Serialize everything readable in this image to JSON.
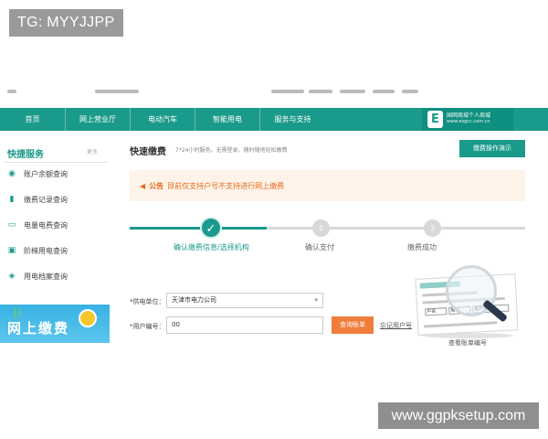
{
  "overlays": {
    "tg_label": "TG: MYYJJPP",
    "watermark": "www.ggpksetup.com"
  },
  "navbar": {
    "items": [
      {
        "label": "首页"
      },
      {
        "label": "网上营业厅"
      },
      {
        "label": "电动汽车"
      },
      {
        "label": "智能用电"
      },
      {
        "label": "服务与支持"
      }
    ],
    "brand_name": "国网商城个人商城",
    "brand_url": "www.esgcc.com.cn",
    "brand_logo_icon": "e-logo-icon"
  },
  "sidebar": {
    "title": "快捷服务",
    "more": "更多",
    "items": [
      {
        "label": "账户余额查询",
        "icon": "balance-icon"
      },
      {
        "label": "缴费记录查询",
        "icon": "bar-chart-icon"
      },
      {
        "label": "电量电费查询",
        "icon": "monitor-icon"
      },
      {
        "label": "阶梯用电查询",
        "icon": "ladder-icon"
      },
      {
        "label": "用电档案查询",
        "icon": "archive-icon"
      }
    ],
    "banner_text": "网上缴费"
  },
  "main": {
    "title": "快速缴费",
    "description": "7*24小时服务，无需登录，随时随地轻松缴费",
    "howto_button": "缴费操作演示",
    "notice_label": "公告",
    "notice_text": "目前仅支持户号不支持进行网上缴费",
    "steps": [
      {
        "number": "✓",
        "label": "确认缴费信息/选择机构",
        "state": "active"
      },
      {
        "number": "2",
        "label": "确认支付",
        "state": "idle"
      },
      {
        "number": "3",
        "label": "缴费成功",
        "state": "idle"
      }
    ],
    "form": {
      "unit_label": "*供电单位：",
      "unit_value": "天津市电力公司",
      "account_label": "*用户编号：",
      "account_value": "00",
      "query_button": "查询账单",
      "forgot_link": "忘记用户号"
    },
    "bill_caption": "查看账单编号",
    "bill_cells": [
      "户名",
      "地址",
      "用户编号"
    ]
  }
}
